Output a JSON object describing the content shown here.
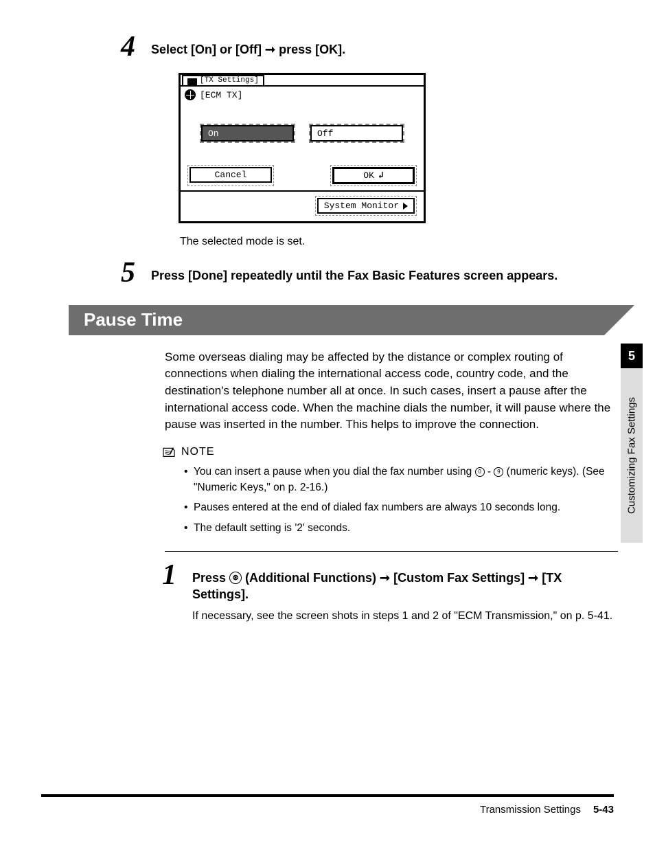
{
  "side_tab": {
    "chapter_num": "5",
    "chapter_title": "Customizing Fax Settings"
  },
  "step4": {
    "num": "4",
    "head_a": "Select [On] or [Off] ",
    "head_b": " press [OK].",
    "caption": "The selected mode is set."
  },
  "device": {
    "back_tab": "[TX Settings]",
    "title": "[ECM TX]",
    "opt_on": "On",
    "opt_off": "Off",
    "cancel": "Cancel",
    "ok": "OK",
    "sysmon": "System Monitor"
  },
  "step5": {
    "num": "5",
    "text": "Press [Done] repeatedly until the Fax Basic Features screen appears."
  },
  "section": {
    "title": "Pause Time"
  },
  "intro": "Some overseas dialing may be affected by the distance or complex routing of connections when dialing the international access code, country code, and the destination's telephone number all at once. In such cases, insert a pause after the international access code. When the machine dials the number, it will pause where the pause was inserted in the number. This helps to improve the connection.",
  "note": {
    "label": "NOTE",
    "b1_a": "You can insert a pause when you dial the fax number using ",
    "b1_zero": "0",
    "b1_dash": " - ",
    "b1_nine": "9",
    "b1_b": " (numeric keys). (See \"Numeric Keys,\" on p. 2-16.)",
    "b2": "Pauses entered at the end of dialed fax numbers are always 10 seconds long.",
    "b3": "The default setting is '2' seconds."
  },
  "step1": {
    "num": "1",
    "a": "Press ",
    "af": "⊛",
    "b": " (Additional Functions) ",
    "c": " [Custom Fax Settings] ",
    "d": " [TX Settings].",
    "sub": "If necessary, see the screen shots in steps 1 and 2 of \"ECM Transmission,\" on p. 5-41."
  },
  "footer": {
    "section": "Transmission Settings",
    "page": "5-43"
  },
  "glyphs": {
    "arrow": "➞",
    "enter": "↲",
    "tri": "▶"
  }
}
